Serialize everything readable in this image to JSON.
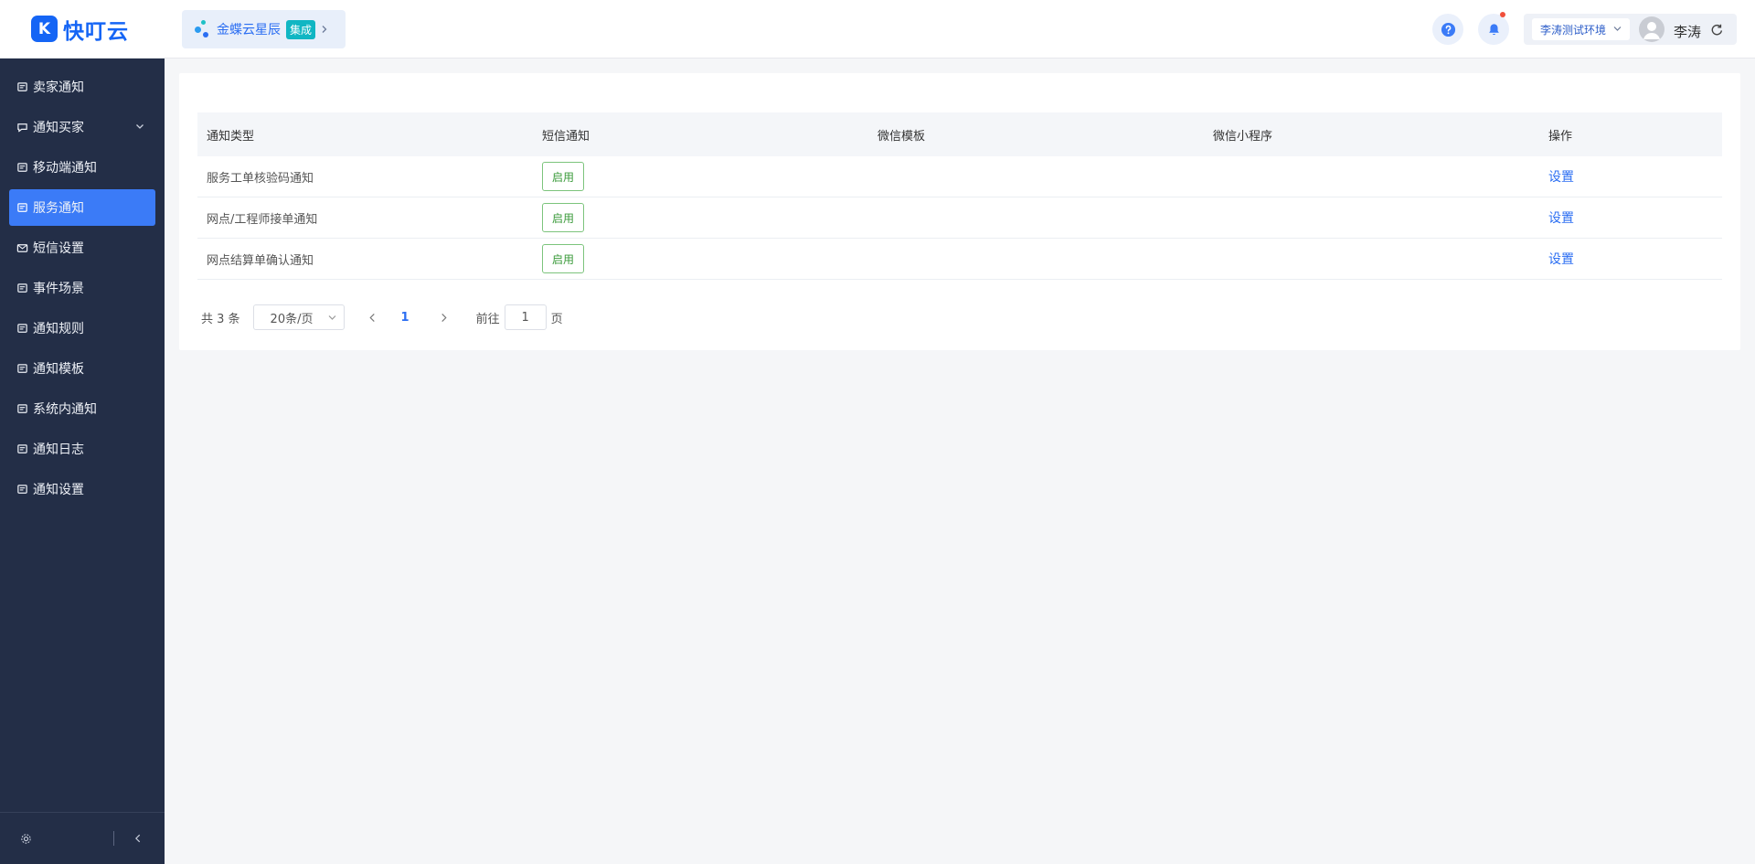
{
  "brand": {
    "logo_letter": "K",
    "name": "快叮云"
  },
  "header": {
    "app_name": "金蝶云星辰",
    "app_badge": "集成",
    "env": "李涛测试环境",
    "user_name": "李涛"
  },
  "sidebar": {
    "items": [
      {
        "label": "卖家通知"
      },
      {
        "label": "通知买家"
      },
      {
        "label": "移动端通知"
      },
      {
        "label": "服务通知"
      },
      {
        "label": "短信设置"
      },
      {
        "label": "事件场景"
      },
      {
        "label": "通知规则"
      },
      {
        "label": "通知模板"
      },
      {
        "label": "系统内通知"
      },
      {
        "label": "通知日志"
      },
      {
        "label": "通知设置"
      }
    ]
  },
  "table": {
    "headers": [
      "通知类型",
      "短信通知",
      "微信模板",
      "微信小程序",
      "操作"
    ],
    "rows": [
      {
        "type": "服务工单核验码通知",
        "sms": "启用",
        "action": "设置"
      },
      {
        "type": "网点/工程师接单通知",
        "sms": "启用",
        "action": "设置"
      },
      {
        "type": "网点结算单确认通知",
        "sms": "启用",
        "action": "设置"
      }
    ]
  },
  "pagination": {
    "total": "共 3 条",
    "page_size": "20条/页",
    "current_page": "1",
    "goto_label": "前往",
    "goto_value": "1",
    "page_unit": "页"
  },
  "colors": {
    "accent": "#3b7bf7",
    "sidebar_bg": "#232e47",
    "enabled_green": "#3a9a3a"
  }
}
